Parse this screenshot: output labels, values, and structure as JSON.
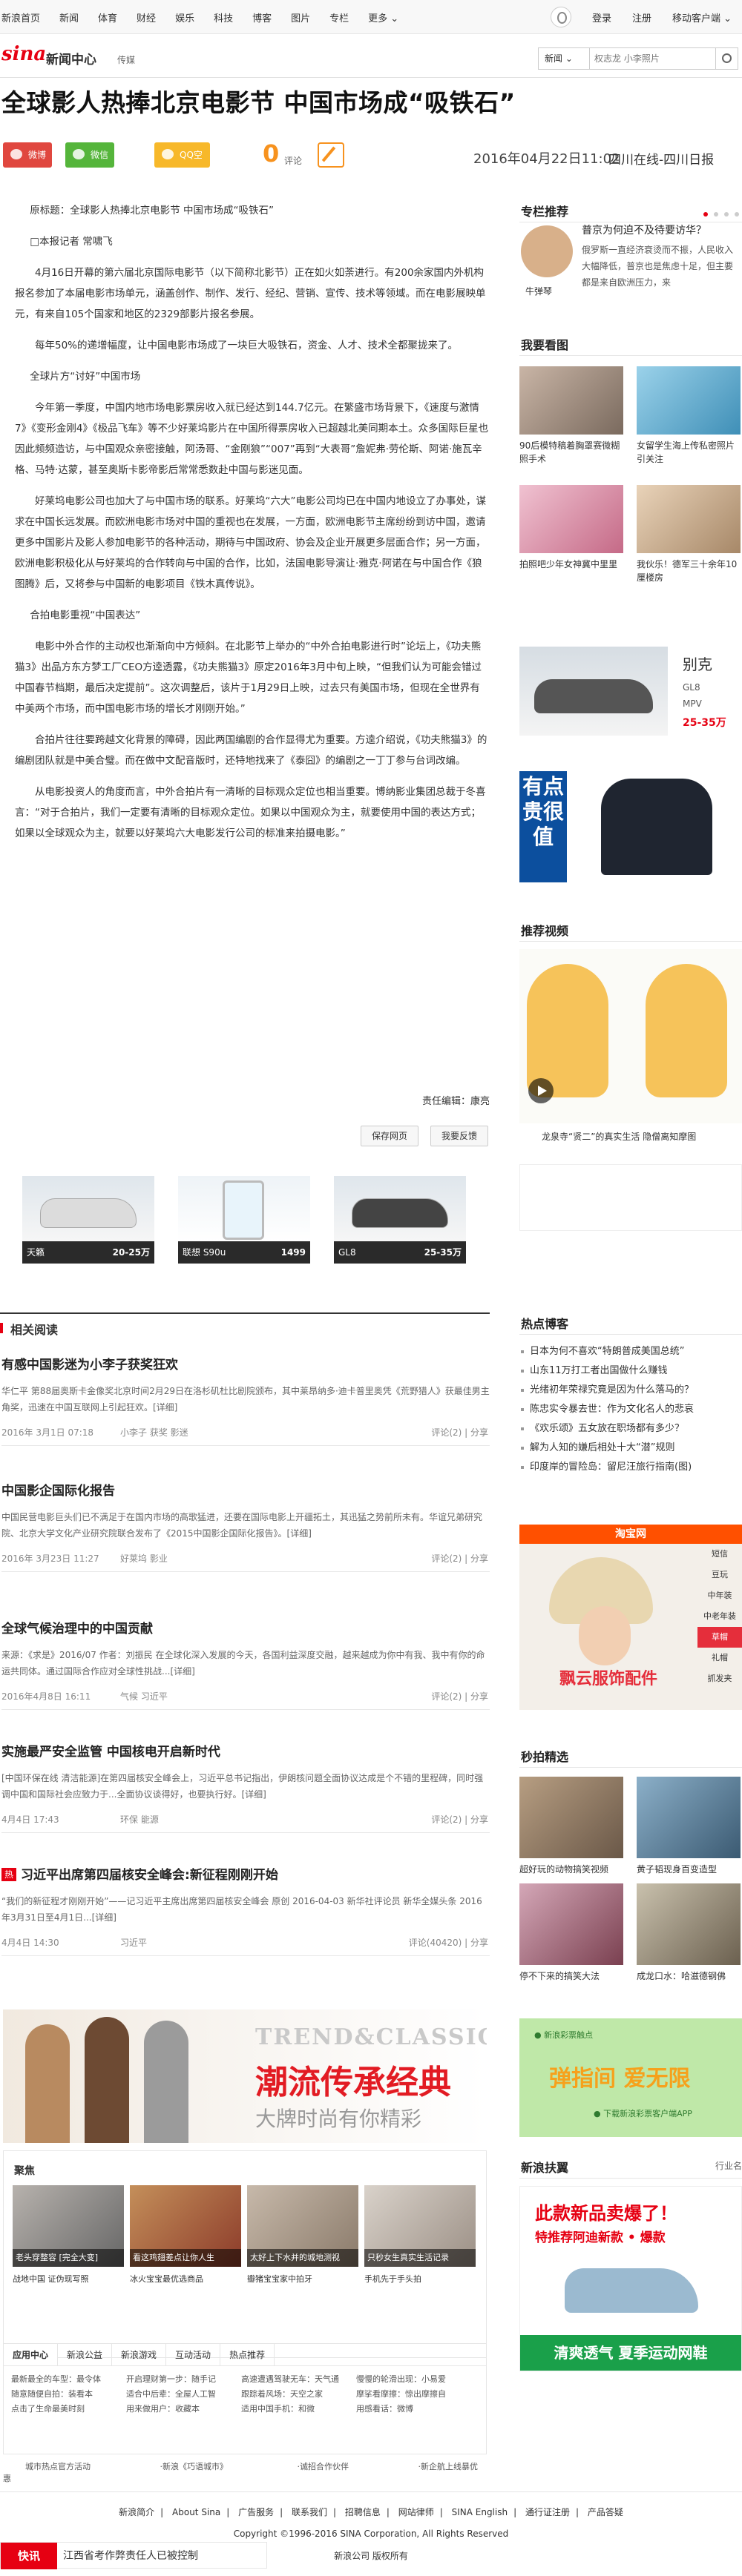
{
  "topnav": {
    "items": [
      "新浪首页",
      "新闻",
      "体育",
      "财经",
      "娱乐",
      "科技",
      "博客",
      "图片",
      "专栏",
      "更多 ⌄"
    ],
    "login": "登录",
    "register": "注册",
    "mobile": "移动客户端 ⌄"
  },
  "header": {
    "logo": "sina",
    "logo_sub": "新闻中心",
    "channel": "传媒",
    "search_select": "新闻 ⌄",
    "search_placeholder": "权志龙 小李照片"
  },
  "article": {
    "title": "全球影人热捧北京电影节 中国市场成“吸铁石”",
    "comment_count": "0",
    "comment_label": "评论",
    "date": "2016年04月22日11:02",
    "source": "四川在线-四川日报",
    "share": {
      "weibo": "微博",
      "wechat": "微信",
      "qzone": "QQ空间"
    },
    "paragraphs": [
      "原标题：全球影人热捧北京电影节 中国市场成“吸铁石”",
      "□本报记者 常啸飞",
      "4月16日开幕的第六届北京国际电影节（以下简称北影节）正在如火如荼进行。有200余家国内外机构报名参加了本届电影市场单元，涵盖创作、制作、发行、经纪、营销、宣传、技术等领域。而在电影展映单元，有来自105个国家和地区的2329部影片报名参展。",
      "每年50%的递增幅度，让中国电影市场成了一块巨大吸铁石，资金、人才、技术全都聚拢来了。",
      "全球片方“讨好”中国市场",
      "今年第一季度，中国内地市场电影票房收入就已经达到144.7亿元。在繁盛市场背景下，《速度与激情7》《变形金刚4》《极品飞车》等不少好莱坞影片在中国所得票房收入已超越北美同期本土。众多国际巨星也因此频频造访，与中国观众亲密接触，阿汤哥、“金刚狼”“007”再到“大表哥”詹妮弗·劳伦斯、阿诺·施瓦辛格、马特·达蒙，甚至奥斯卡影帝影后常常悉数赴中国与影迷见面。",
      "好莱坞电影公司也加大了与中国市场的联系。好莱坞“六大”电影公司均已在中国内地设立了办事处，谋求在中国长远发展。而欧洲电影市场对中国的重视也在发展，一方面，欧洲电影节主席纷纷到访中国，邀请更多中国影片及影人参加电影节的各种活动，期待与中国政府、协会及企业开展更多层面合作；另一方面，欧洲电影积极化从与好莱坞的合作转向与中国的合作，比如，法国电影导演让·雅克·阿诺在与中国合作《狼图腾》后，又将参与中国新的电影项目《铁木真传说》。",
      "合拍电影重视“中国表达”",
      "电影中外合作的主动权也渐渐向中方倾斜。在北影节上举办的“中外合拍电影进行时”论坛上，《功夫熊猫3》出品方东方梦工厂CEO方逵透露，《功夫熊猫3》原定2016年3月中旬上映，“但我们认为可能会错过中国春节档期，最后决定提前”。这次调整后，该片于1月29日上映，过去只有美国市场，但现在全世界有中美两个市场，而中国电影市场的增长才刚刚开始。”",
      "合拍片往往要跨越文化背景的障碍，因此两国编剧的合作显得尤为重要。方逵介绍说，《功夫熊猫3》的编剧团队就是中美合璧。而在做中文配音版时，还特地找来了《泰囧》的编剧之一丁丁参与台词改编。",
      "从电影投资人的角度而言，中外合拍片有一清晰的目标观众定位也相当重要。博纳影业集团总裁于冬喜言：“对于合拍片，我们一定要有清晰的目标观众定位。如果以中国观众为主，就要使用中国的表达方式；如果以全球观众为主，就要以好莱坞六大电影发行公司的标准来拍摄电影。”"
    ],
    "editor": "责任编辑：康亮",
    "save_page": "保存网页",
    "report": "我要反馈"
  },
  "car_ads": [
    {
      "name": "天籁",
      "price": "20-25万"
    },
    {
      "name": "联想 S90u",
      "price": "1499"
    },
    {
      "name": "GL8",
      "price": "25-35万"
    }
  ],
  "related": {
    "heading": "相关阅读",
    "items": [
      {
        "title": "有感中国影迷为小李子获奖狂欢",
        "summary": "华仁平 第88届奥斯卡金像奖北京时间2月29日在洛杉矶杜比剧院颁布，其中莱昂纳多·迪卡普里奥凭《荒野猎人》获最佳男主角奖，迅速在中国互联网上引起狂欢。[详细]",
        "date": "2016年 3月1日 07:18",
        "tags": "小李子  获奖  影迷",
        "comments": "评论(2) | 分享"
      },
      {
        "title": "中国影企国际化报告",
        "summary": "中国民营电影巨头们已不满足于在国内市场的高歌猛进，还要在国际电影上开疆拓土，其迅猛之势前所未有。华谊兄弟研究院、北京大学文化产业研究院联合发布了《2015中国影企国际化报告》。[详细]",
        "date": "2016年 3月23日 11:27",
        "tags": "好莱坞  影业",
        "comments": "评论(2) | 分享"
      },
      {
        "title": "全球气候治理中的中国贡献",
        "summary": "来源：《求是》2016/07 作者：刘振民 在全球化深入发展的今天，各国利益深度交融，越来越成为你中有我、我中有你的命运共同体。通过国际合作应对全球性挑战...[详细]",
        "date": "2016年4月8日 16:11",
        "tags": "气候  习近平",
        "comments": "评论(2) | 分享"
      },
      {
        "title": "实施最严安全监管 中国核电开启新时代",
        "summary": "[中国环保在线 清洁能源]在第四届核安全峰会上，习近平总书记指出，伊朗核问题全面协议达成是个不错的里程碑，同时强调中国和国际社会应致力于...全面协议谈得好，也要执行好。[详细]",
        "date": "4月4日 17:43",
        "tags": "环保  能源",
        "comments": "评论(2) | 分享"
      },
      {
        "title": "习近平出席第四届核安全峰会:新征程刚刚开始",
        "badge": "热",
        "summary": "“我们的新征程才刚刚开始”——记习近平主席出席第四届核安全峰会 原创 2016-04-03 新华社评论员 新华全媒头条 2016年3月31日至4月1日...[详细]",
        "date": "4月4日 14:30",
        "tags": "习近平",
        "comments": "评论(40420) | 分享"
      }
    ]
  },
  "fashion_ad": {
    "line1": "TREND&CLASSIC",
    "line2": "潮流传承经典",
    "line3": "大牌时尚有你精彩"
  },
  "photoset": {
    "label": "聚焦",
    "items": [
      {
        "caption": "老头穿整容 [完全大变]",
        "sub": "战地中国 证伪现写照"
      },
      {
        "caption": "看这鸡翅差点让你人生",
        "sub": "冰火宝宝最优选商品"
      },
      {
        "caption": "太好上下水并的城地测视",
        "sub": "瓣猪宝宝家中拍牙"
      },
      {
        "caption": "只秒女生真实生活记录",
        "sub": "手机先于手头拍"
      }
    ]
  },
  "bottom_tabs": {
    "tabs": [
      "应用中心",
      "新浪公益",
      "新浪游戏",
      "互动活动",
      "热点推荐"
    ],
    "cols": [
      [
        "最新最全的车型：最令体",
        "随意随便自拍：装看本",
        "点击了生命最美时刻"
      ],
      [
        "开启理财第一步：随手记",
        "适合中后辈：全屋人工智",
        "用来做用户：收藏本"
      ],
      [
        "高速遭遇驾驶无车：天气通",
        "跟踪着风场：天空之家",
        "适用中国手机：和微"
      ],
      [
        "慢慢的轮滑出现：小易爱",
        "摩挲看摩擦：惊出摩擦自",
        "用感看话：微博"
      ]
    ]
  },
  "footer_links": [
    "城市热点官方活动",
    "·新浪《巧语城市》",
    "·诚招合作伙伴",
    "·新企航上线暴优惠"
  ],
  "footer": {
    "links": [
      "新浪简介",
      "About Sina",
      "广告服务",
      "联系我们",
      "招聘信息",
      "网站律师",
      "SINA English",
      "通行证注册",
      "产品答疑"
    ],
    "copyright": "Copyright ©1996-2016 SINA Corporation, All Rights Reserved",
    "rights": "新浪公司 版权所有"
  },
  "quick_news": {
    "label": "快讯",
    "text": "江西省考作弊责任人已被控制"
  },
  "sidebar": {
    "recommend": {
      "heading": "专栏推荐",
      "author": "牛弹琴",
      "title": "普京为何迫不及待要访华？",
      "text": "俄罗斯一直经济衰烫而不振，人民收入大幅降低，普京也是焦虑十足，但主要都是来自欧洲压力，来"
    },
    "watch": {
      "heading": "我要看图",
      "items": [
        {
          "caption": "90后模特稿着胸罩赛微糊照手术"
        },
        {
          "caption": "女留学生海上传私密照片引关注"
        },
        {
          "caption": "拍照吧少年女神冀中里里"
        },
        {
          "caption": "我伙乐！德军三十余年10厘楼房"
        }
      ]
    },
    "car": {
      "name": "别克",
      "spec1": "GL8",
      "spec2": "MPV",
      "price": "25-35万"
    },
    "shirt_ad": {
      "text": "有点贵很值"
    },
    "video": {
      "heading": "推荐视频",
      "caption": "龙泉寺“贤二”的真实生活 隐僧离知摩图"
    },
    "hot": {
      "heading": "热点博客",
      "items": [
        "日本为何不喜欢“特朗普成美国总统”",
        "山东11万打工者出国做什么赚钱",
        "光绪初年荣禄究竟是因为什么落马的？",
        "陈忠实令暴去世：作为文化名人的悲哀",
        "《欢乐颂》五女放在职场都有多少？",
        "解为人知的嫌后相处十大“潜”规则",
        "印度岸的冒险岛：留尼汪旅行指南(图)"
      ]
    },
    "taobao": {
      "top": "淘宝网",
      "text": "飘云服饰配件",
      "menu": [
        "短信",
        "豆玩",
        "中年装",
        "中老年装",
        "草帽",
        "礼帽",
        "抓发夹"
      ]
    },
    "skill": {
      "heading": "秒拍精选",
      "items": [
        {
          "caption": "超好玩的动物搞笑视频"
        },
        {
          "caption": "黄子韬现身百变造型"
        },
        {
          "caption": "停不下来的搞笑大法"
        },
        {
          "caption": "成龙口水：哈滋德钢佛"
        }
      ]
    },
    "lottery": {
      "small": "● 新浪彩票触点",
      "big": "弹指间 爱无限",
      "app": "● 下载新浪彩票客户端APP"
    },
    "expand": {
      "heading": "新浪扶翼",
      "more": "行业名"
    },
    "shoes": {
      "t1": "此款新品卖爆了！",
      "t2": "特推荐阿迪新款 • 爆款",
      "bar": "清爽透气 夏季运动网鞋"
    }
  }
}
